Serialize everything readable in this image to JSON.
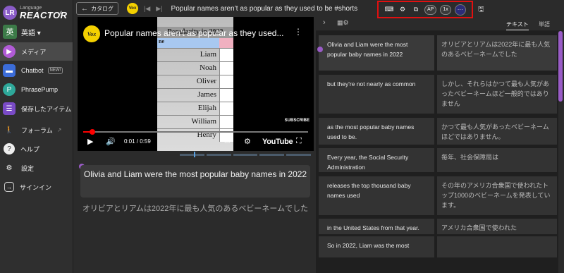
{
  "app": {
    "logo_small": "Language",
    "logo_big": "REACTOR"
  },
  "sidebar": {
    "language_badge": "英",
    "language_label": "英語 ▾",
    "items": [
      {
        "label": "メディア",
        "icon": "play-icon",
        "color": "#b15bd6"
      },
      {
        "label": "Chatbot",
        "badge": "NEW!",
        "icon": "chat-icon",
        "color": "#3b6cd8"
      },
      {
        "label": "PhrasePump",
        "icon": "phrasepump-icon",
        "color": "#2ea89a"
      },
      {
        "label": "保存したアイテム",
        "icon": "list-icon",
        "color": "#7a4bc7"
      },
      {
        "label": "フォーラム",
        "icon": "walk-icon"
      },
      {
        "label": "ヘルプ",
        "icon": "help-icon"
      },
      {
        "label": "設定",
        "icon": "gear-icon"
      },
      {
        "label": "サインイン",
        "icon": "signin-icon"
      }
    ]
  },
  "topbar": {
    "catalog_label": "カタログ",
    "channel_badge": "Vox",
    "title": "Popular names aren’t as popular as they used to be #shorts",
    "tools": {
      "ap": "AP",
      "speed": "1x",
      "more": "···"
    }
  },
  "video": {
    "channel": "Vox",
    "title": "Popular names aren't as popular as they used...",
    "card_header": "Popularity in 2022",
    "card_subhead": "ne",
    "names": [
      "Liam",
      "Noah",
      "Oliver",
      "James",
      "Elijah",
      "William",
      "Henry"
    ],
    "subscribe": "SUBSCRIBE",
    "time": "0:01 / 0:59",
    "brand": "YouTube",
    "progress": 0.04
  },
  "subtitle": {
    "text": "Olivia and Liam were the most popular baby names in 2022",
    "translation": "オリビアとリアムは2022年に最も人気のあるベビーネームでした"
  },
  "panel": {
    "tabs": [
      "テキスト",
      "単語"
    ],
    "rows": [
      {
        "en": "Olivia and Liam were the most popular baby names in 2022",
        "ja": "オリビアとリアムは2022年に最も人気のあるベビーネームでした",
        "active": true
      },
      {
        "en": "but they're not nearly as common",
        "ja": "しかし、それらはかつて最も人気があったベビーネームほど一般的ではありません"
      },
      {
        "en": "as the most popular baby names used to be.",
        "ja": "かつて最も人気があったベビーネームほどではありません。"
      },
      {
        "en": "Every year, the Social Security Administration",
        "ja": "毎年、社会保障局は"
      },
      {
        "en": "releases the top thousand baby names used",
        "ja": "その年のアメリカ合衆国で使われたトップ1000のベビーネームを発表しています。"
      },
      {
        "en": "in the United States from that year.",
        "ja": "アメリカ合衆国で使われた"
      },
      {
        "en": "So in 2022, Liam was the most",
        "ja": ""
      }
    ]
  }
}
